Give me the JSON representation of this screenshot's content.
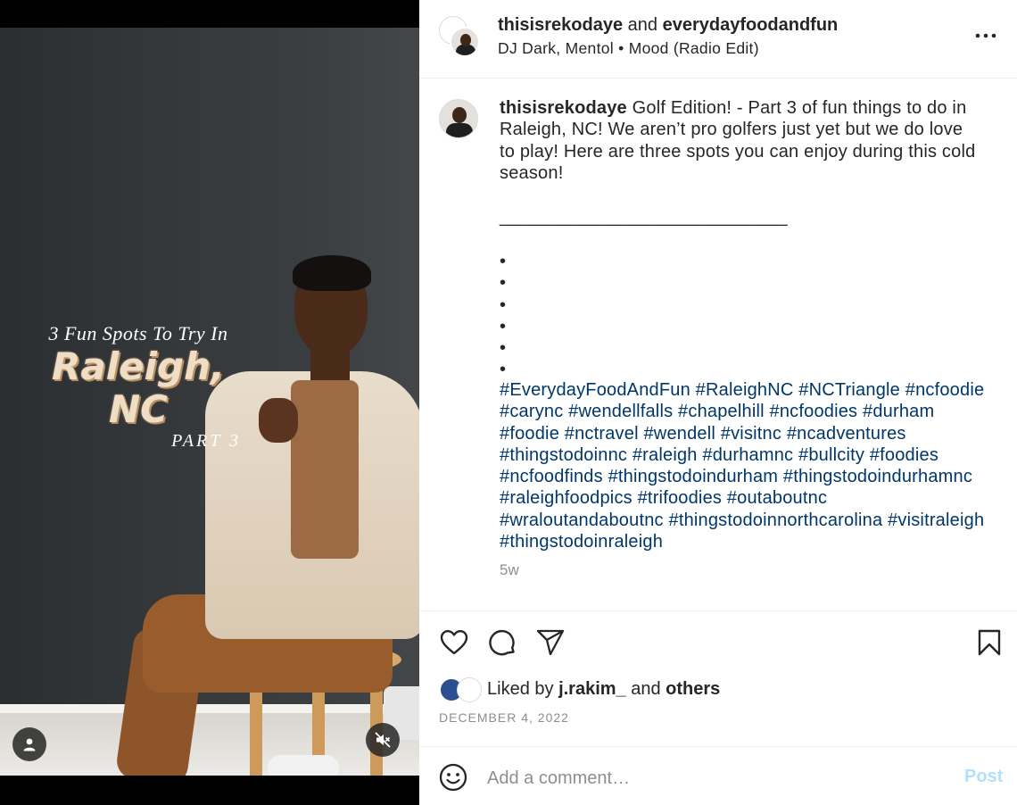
{
  "media": {
    "overlay_line1": "3 Fun Spots To Try In",
    "overlay_line2": "Raleigh, NC",
    "overlay_line3": "PART 3",
    "tag_icon": "person-icon",
    "mute_icon": "speaker-muted-icon"
  },
  "header": {
    "user1": "thisisrekodaye",
    "conjunction": "and",
    "user2": "everydayfoodandfun",
    "music": "DJ Dark, Mentol • Mood (Radio Edit)"
  },
  "caption": {
    "username": "thisisrekodaye",
    "text": " Golf Edition! - Part 3 of fun things to do in Raleigh, NC! We aren’t pro golfers just yet but we do love to play! Here are three spots you can enjoy during this cold season!",
    "separator": "_____________________________",
    "dots": "•\n•\n•\n•\n•\n•",
    "hashtags": "#EverydayFoodAndFun #RaleighNC #NCTriangle #ncfoodie #carync #wendellfalls #chapelhill #ncfoodies #durham #foodie #nctravel #wendell #visitnc #ncadventures #thingstodoinnc #raleigh #durhamnc #bullcity #foodies #ncfoodfinds #thingstodoindurham #thingstodoindurhamnc #raleighfoodpics #trifoodies #outaboutnc #wraloutandaboutnc #thingstodoinnorthcarolina #visitraleigh #thingstodoinraleigh",
    "time_ago": "5w"
  },
  "actions": {
    "liked_by_prefix": "Liked by",
    "liked_by_user": "j.rakim_",
    "liked_by_and": "and",
    "liked_by_others": "others",
    "date": "DECEMBER 4, 2022"
  },
  "comment": {
    "placeholder": "Add a comment…",
    "post_label": "Post"
  },
  "colors": {
    "hashtag": "#00376b",
    "muted": "#8e8e8e",
    "post_disabled": "#b2dffc"
  }
}
